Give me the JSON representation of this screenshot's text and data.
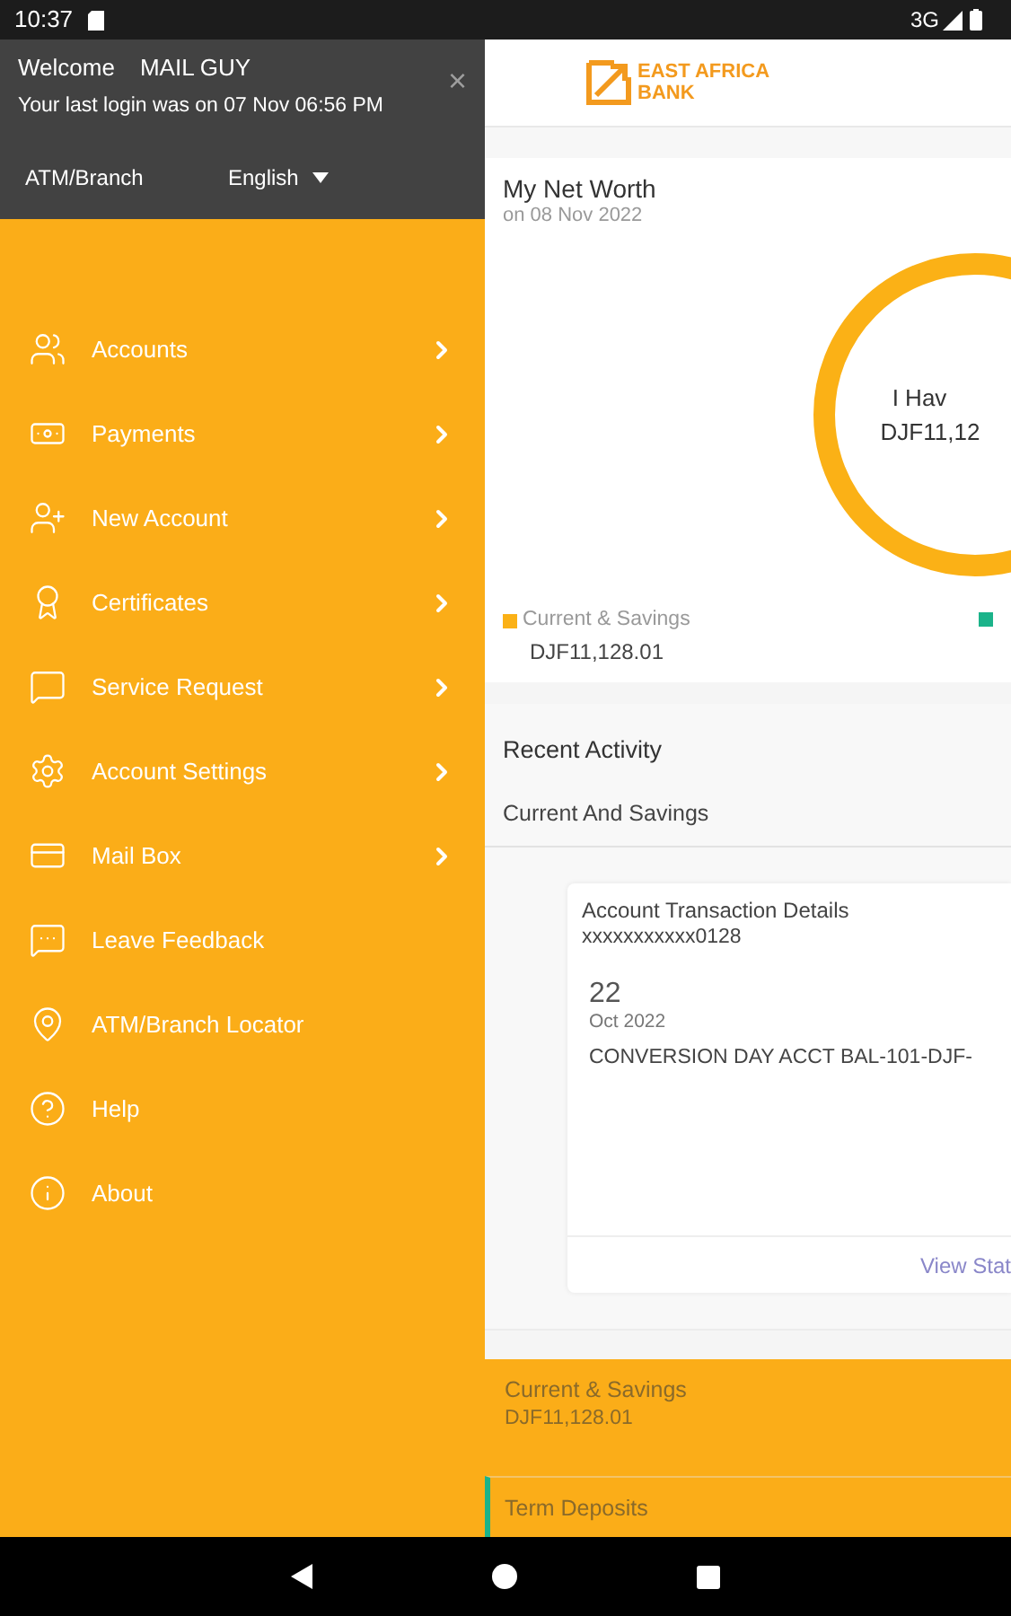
{
  "status_bar": {
    "time": "10:37",
    "network": "3G"
  },
  "drawer": {
    "welcome": "Welcome",
    "user": "MAIL GUY",
    "last_login": "Your last login was on 07 Nov 06:56 PM",
    "close": "×",
    "atm_link": "ATM/Branch",
    "language": "English",
    "items": [
      {
        "label": "Accounts",
        "has_submenu": true
      },
      {
        "label": "Payments",
        "has_submenu": true
      },
      {
        "label": "New Account",
        "has_submenu": true
      },
      {
        "label": "Certificates",
        "has_submenu": true
      },
      {
        "label": "Service Request",
        "has_submenu": true
      },
      {
        "label": "Account Settings",
        "has_submenu": true
      },
      {
        "label": "Mail Box",
        "has_submenu": true
      },
      {
        "label": "Leave Feedback",
        "has_submenu": false
      },
      {
        "label": "ATM/Branch Locator",
        "has_submenu": false
      },
      {
        "label": "Help",
        "has_submenu": false
      },
      {
        "label": "About",
        "has_submenu": false
      }
    ]
  },
  "logo": {
    "line1": "EAST AFRICA",
    "line2": "BANK"
  },
  "net_worth": {
    "title": "My Net Worth",
    "date": "on 08 Nov 2022",
    "center_label": "I Hav",
    "center_value": "DJF11,12",
    "legend": [
      {
        "label": "Current & Savings",
        "value": "DJF11,128.01",
        "color": "#fbb116"
      },
      {
        "color": "#1bb38a"
      }
    ]
  },
  "recent_activity": {
    "title": "Recent Activity",
    "tab": "Current And Savings",
    "card": {
      "title": "Account Transaction Details",
      "account": "xxxxxxxxxxx0128",
      "day": "22",
      "month": "Oct 2022",
      "description": "CONVERSION DAY ACCT BAL-101-DJF-",
      "link": "View Stat"
    }
  },
  "accounts": [
    {
      "label": "Current & Savings",
      "value": "DJF11,128.01",
      "color": "#fbad18"
    },
    {
      "label": "Term Deposits",
      "color": "#1bb38a"
    }
  ]
}
